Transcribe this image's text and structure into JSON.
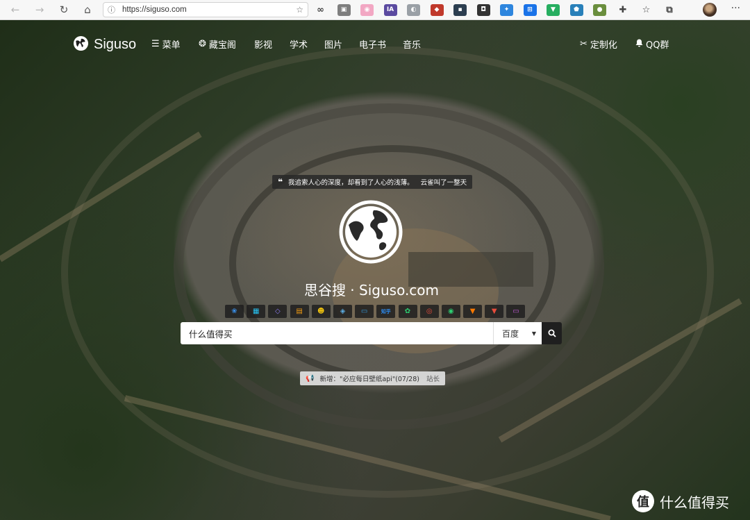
{
  "browser": {
    "url": "https://siguso.com",
    "extensions": [
      {
        "icon": "infinity-icon",
        "glyph": "∞",
        "color": ""
      },
      {
        "icon": "tab-icon",
        "glyph": "▣",
        "color": "#7e7e7e"
      },
      {
        "icon": "cat-icon",
        "glyph": "◉",
        "color": "#f2a7c3"
      },
      {
        "icon": "ia-icon",
        "glyph": "IA",
        "color": "#5b4aa0"
      },
      {
        "icon": "mouse-icon",
        "glyph": "◐",
        "color": "#9aa0a6"
      },
      {
        "icon": "shield-badge-icon",
        "glyph": "◆",
        "color": "#c0392b"
      },
      {
        "icon": "terminal-icon",
        "glyph": "▪",
        "color": "#2c3e50"
      },
      {
        "icon": "camera-icon",
        "glyph": "◘",
        "color": "#333333"
      },
      {
        "icon": "bird-icon",
        "glyph": "✦",
        "color": "#2e86de"
      },
      {
        "icon": "translate-icon",
        "glyph": "⊞",
        "color": "#1a73e8"
      },
      {
        "icon": "offline-icon",
        "glyph": "▼",
        "color": "#27ae60"
      },
      {
        "icon": "shield-icon",
        "glyph": "⬟",
        "color": "#2980b9"
      },
      {
        "icon": "globe-ext-icon",
        "glyph": "●",
        "color": "#6a8e3d"
      },
      {
        "icon": "puzzle-icon",
        "glyph": "✚",
        "color": ""
      },
      {
        "icon": "favorites-icon",
        "glyph": "☆",
        "color": ""
      },
      {
        "icon": "collections-icon",
        "glyph": "⧉",
        "color": ""
      }
    ]
  },
  "nav": {
    "brand": "Siguso",
    "items": [
      {
        "label": "菜单",
        "icon": "menu-icon",
        "glyph": "☰"
      },
      {
        "label": "藏宝阁",
        "icon": "treasure-icon",
        "glyph": "❂"
      },
      {
        "label": "影视",
        "icon": "",
        "glyph": ""
      },
      {
        "label": "学术",
        "icon": "",
        "glyph": ""
      },
      {
        "label": "图片",
        "icon": "",
        "glyph": ""
      },
      {
        "label": "电子书",
        "icon": "",
        "glyph": ""
      },
      {
        "label": "音乐",
        "icon": "",
        "glyph": ""
      }
    ],
    "right": [
      {
        "label": "定制化",
        "icon": "tools-icon",
        "glyph": "✂"
      },
      {
        "label": "QQ群",
        "icon": "bell-icon",
        "glyph": "🔔"
      }
    ]
  },
  "quote": {
    "text": "我追索人心的深度，却看到了人心的浅薄。",
    "author": "云雀叫了一整天"
  },
  "site_title": "思谷搜 · Siguso.com",
  "engines": [
    {
      "name": "baidu-engine",
      "glyph": "❀",
      "color": "#3a8ee6"
    },
    {
      "name": "bing-engine",
      "glyph": "▦",
      "color": "#27c3f3"
    },
    {
      "name": "duckduckgo-engine",
      "glyph": "◇",
      "color": "#8c7cf0"
    },
    {
      "name": "video-engine",
      "glyph": "▤",
      "color": "#f39c12"
    },
    {
      "name": "sogou-engine",
      "glyph": "☻",
      "color": "#f1c40f"
    },
    {
      "name": "360-engine",
      "glyph": "◈",
      "color": "#5dade2"
    },
    {
      "name": "card-engine",
      "glyph": "▭",
      "color": "#3498db"
    },
    {
      "name": "zhihu-engine",
      "glyph": "知乎",
      "color": "#2d8cf0"
    },
    {
      "name": "plant-engine",
      "glyph": "✿",
      "color": "#2ecc71"
    },
    {
      "name": "weibo-engine",
      "glyph": "◎",
      "color": "#e74c3c"
    },
    {
      "name": "wechat-engine",
      "glyph": "◉",
      "color": "#2ecc71"
    },
    {
      "name": "taobao-engine",
      "glyph": "▼",
      "color": "#ff7a00"
    },
    {
      "name": "jd-engine",
      "glyph": "▼",
      "color": "#e74c3c"
    },
    {
      "name": "tv-engine",
      "glyph": "▭",
      "color": "#c35bd6"
    }
  ],
  "search": {
    "value": "什么值得买",
    "engine": "百度"
  },
  "notice": {
    "text": "新增：\"必应每日壁纸api\"(07/28)",
    "author": "站长"
  },
  "watermark": {
    "text": "什么值得买",
    "badge": "值"
  }
}
